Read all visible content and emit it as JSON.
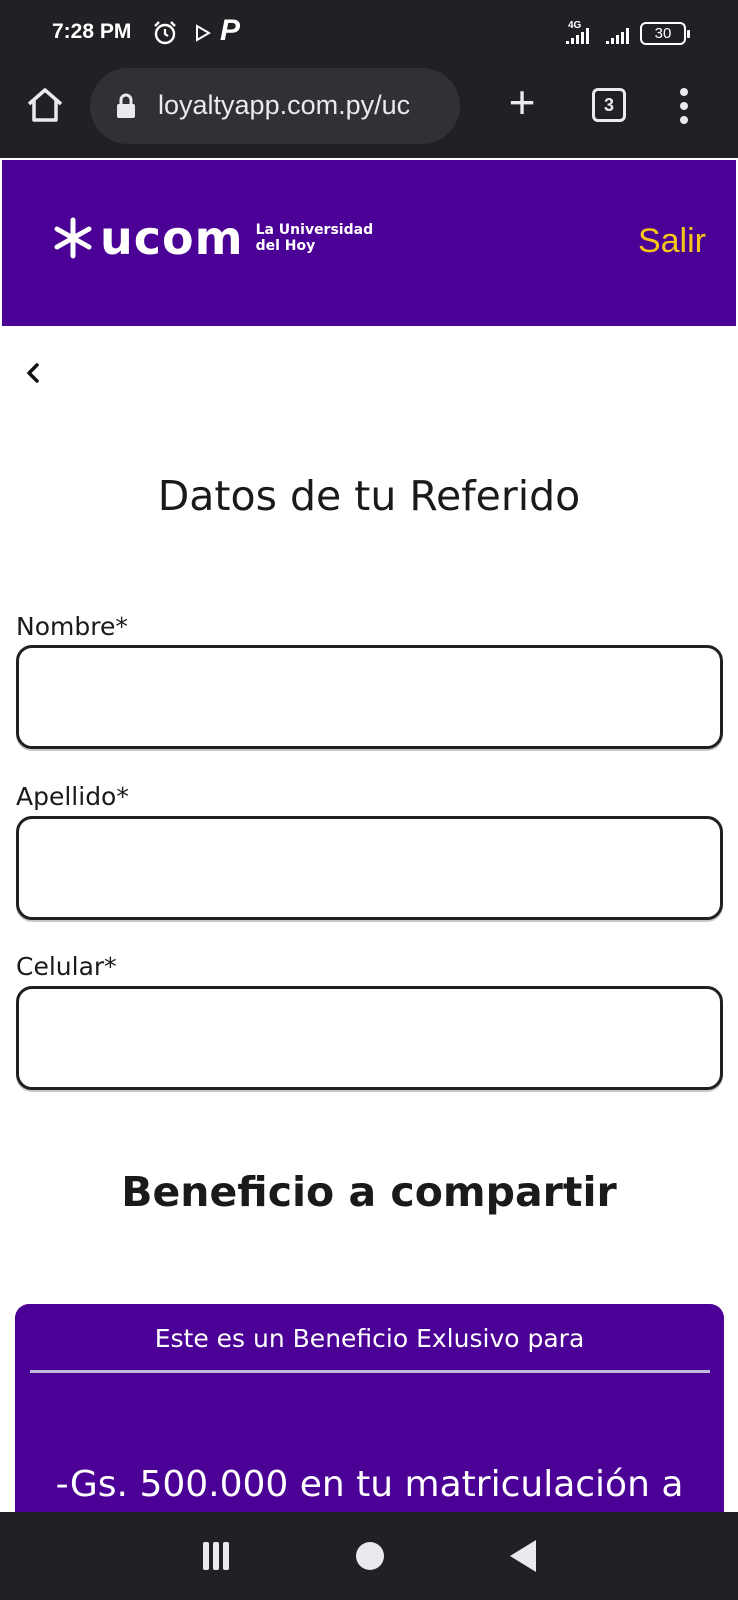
{
  "status_bar": {
    "time": "7:28 PM",
    "network": "4G",
    "battery": "30",
    "icons": [
      "alarm-icon",
      "play-icon",
      "parking-icon",
      "signal-icon",
      "battery-icon"
    ]
  },
  "browser": {
    "url": "loyaltyapp.com.py/uc",
    "tab_count": "3",
    "icons": [
      "home-icon",
      "lock-icon",
      "plus-icon",
      "tabs-icon",
      "more-vert-icon"
    ]
  },
  "header": {
    "brand": "ucom",
    "tagline_line1": "La Universidad",
    "tagline_line2": "del Hoy",
    "logout_label": "Salir",
    "colors": {
      "brand_purple": "#4b0096",
      "logout_yellow": "#f5c518"
    }
  },
  "form": {
    "title": "Datos de tu Referido",
    "fields": [
      {
        "label": "Nombre*",
        "value": ""
      },
      {
        "label": "Apellido*",
        "value": ""
      },
      {
        "label": "Celular*",
        "value": ""
      }
    ]
  },
  "benefit": {
    "section_title": "Beneficio a compartir",
    "card_header": "Este es un Beneficio Exlusivo para",
    "card_text": "-Gs. 500.000 en tu matriculación a"
  },
  "nav_bar": {
    "icons": [
      "recent-apps-icon",
      "home-circle-icon",
      "back-triangle-icon"
    ]
  }
}
